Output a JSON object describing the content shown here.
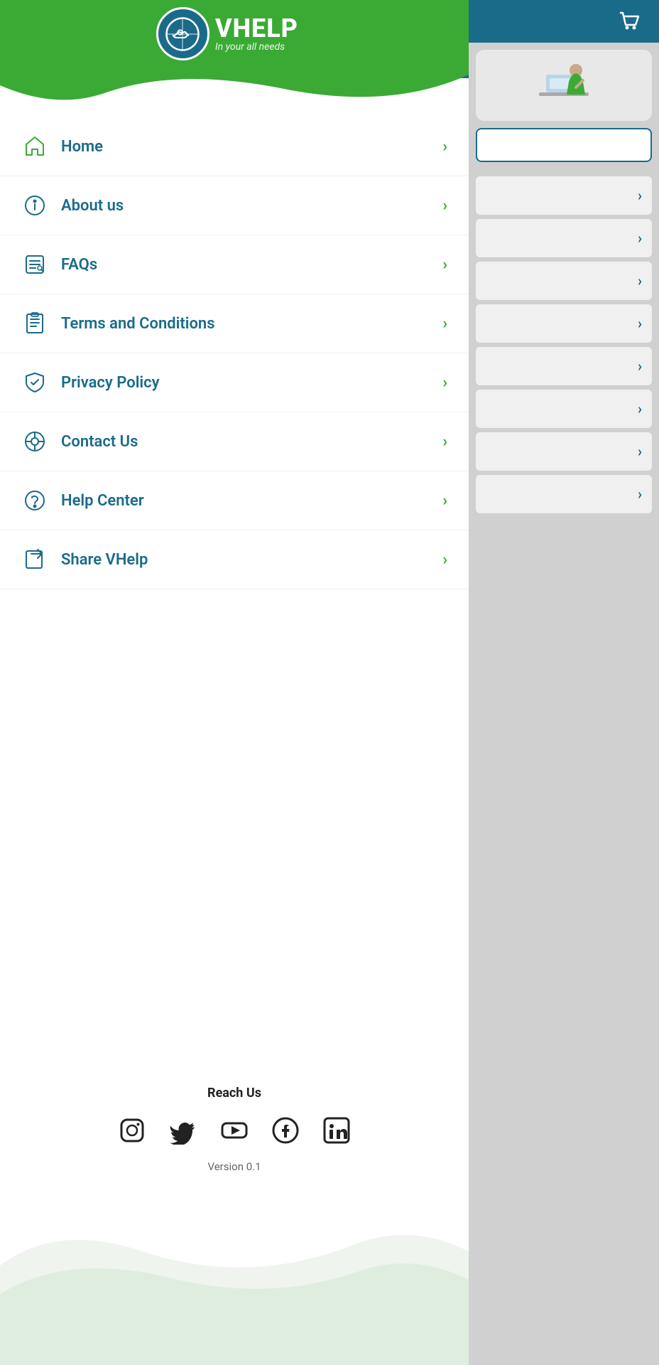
{
  "app": {
    "name": "VHELP",
    "tagline": "In your all needs",
    "version": "Version 0.1"
  },
  "header": {
    "logo_alt": "VHelp Logo"
  },
  "nav": {
    "items": [
      {
        "id": "home",
        "label": "Home",
        "icon": "home-icon"
      },
      {
        "id": "about",
        "label": "About us",
        "icon": "info-icon"
      },
      {
        "id": "faqs",
        "label": "FAQs",
        "icon": "faq-icon"
      },
      {
        "id": "terms",
        "label": "Terms and Conditions",
        "icon": "terms-icon"
      },
      {
        "id": "privacy",
        "label": "Privacy Policy",
        "icon": "shield-icon"
      },
      {
        "id": "contact",
        "label": "Contact Us",
        "icon": "contact-icon"
      },
      {
        "id": "help",
        "label": "Help Center",
        "icon": "help-icon"
      },
      {
        "id": "share",
        "label": "Share VHelp",
        "icon": "share-icon"
      }
    ]
  },
  "footer": {
    "reach_us_label": "Reach Us",
    "version_label": "Version 0.1",
    "social": [
      {
        "name": "instagram",
        "label": "Instagram"
      },
      {
        "name": "twitter",
        "label": "Twitter"
      },
      {
        "name": "youtube",
        "label": "YouTube"
      },
      {
        "name": "facebook",
        "label": "Facebook"
      },
      {
        "name": "linkedin",
        "label": "LinkedIn"
      }
    ]
  },
  "main_content": {
    "list_rows": 8
  },
  "colors": {
    "teal": "#1a6b8a",
    "green": "#3aaa35",
    "white": "#ffffff",
    "dark": "#222222"
  }
}
